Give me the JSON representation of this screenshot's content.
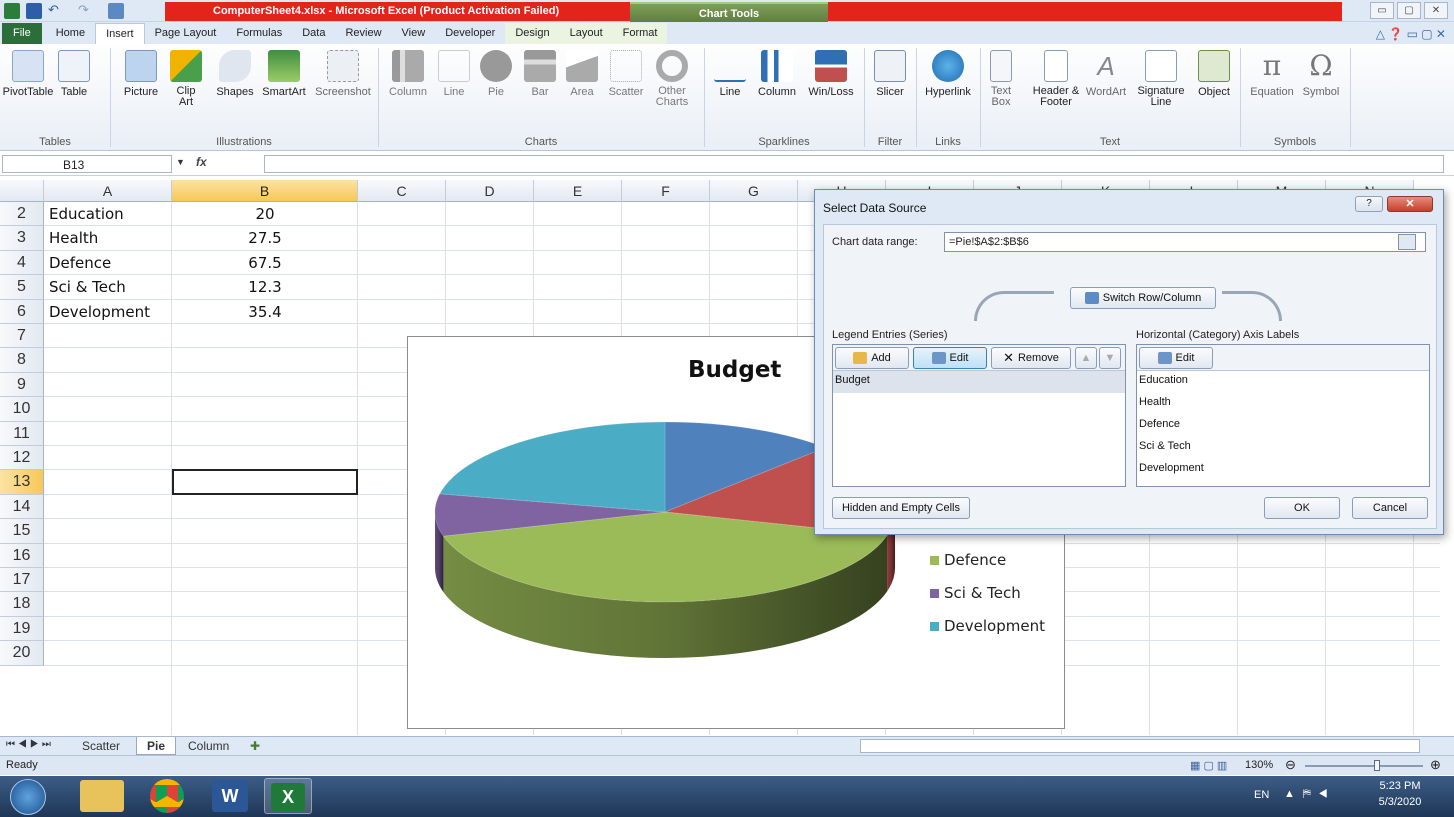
{
  "window": {
    "title": "ComputerSheet4.xlsx - Microsoft Excel (Product Activation Failed)",
    "contextual_tab_group": "Chart Tools",
    "controls": [
      "▭",
      "▢",
      "✕"
    ]
  },
  "tabs": [
    "File",
    "Home",
    "Insert",
    "Page Layout",
    "Formulas",
    "Data",
    "Review",
    "View",
    "Developer",
    "Design",
    "Layout",
    "Format"
  ],
  "active_tab": "Insert",
  "ribbon": {
    "groups": {
      "tables": "Tables",
      "illustrations": "Illustrations",
      "charts": "Charts",
      "sparklines": "Sparklines",
      "filter": "Filter",
      "links": "Links",
      "text": "Text",
      "symbols": "Symbols"
    },
    "buttons": {
      "pivottable": "PivotTable",
      "table": "Table",
      "picture": "Picture",
      "clipart": "Clip Art",
      "shapes": "Shapes",
      "smartart": "SmartArt",
      "screenshot": "Screenshot",
      "column": "Column",
      "line": "Line",
      "pie": "Pie",
      "bar": "Bar",
      "area": "Area",
      "scatter": "Scatter",
      "othercharts": "Other Charts",
      "spark_line": "Line",
      "spark_column": "Column",
      "spark_winloss": "Win/Loss",
      "slicer": "Slicer",
      "hyperlink": "Hyperlink",
      "textbox": "Text Box",
      "headerfooter": "Header & Footer",
      "wordart": "WordArt",
      "signature": "Signature Line",
      "object": "Object",
      "equation": "Equation",
      "symbol": "Symbol"
    }
  },
  "formula_bar": {
    "name_box": "B13",
    "fx": "fx",
    "value": ""
  },
  "columns": [
    "A",
    "B",
    "C",
    "D",
    "E",
    "F",
    "G",
    "H",
    "I",
    "J",
    "K",
    "L",
    "M",
    "N"
  ],
  "selected_column": "B",
  "rows": [
    "2",
    "3",
    "4",
    "5",
    "6",
    "7",
    "8",
    "9",
    "10",
    "11",
    "12",
    "13",
    "14",
    "15",
    "16",
    "17",
    "18",
    "19",
    "20"
  ],
  "selected_row": "13",
  "cells": [
    {
      "a": "Education",
      "b": "20"
    },
    {
      "a": "Health",
      "b": "27.5"
    },
    {
      "a": "Defence",
      "b": "67.5"
    },
    {
      "a": "Sci & Tech",
      "b": "12.3"
    },
    {
      "a": "Development",
      "b": "35.4"
    }
  ],
  "chart_data": {
    "type": "pie",
    "title": "Budget",
    "categories": [
      "Education",
      "Health",
      "Defence",
      "Sci & Tech",
      "Development"
    ],
    "values": [
      20,
      27.5,
      67.5,
      12.3,
      35.4
    ],
    "colors": [
      "#4f81bd",
      "#c0504d",
      "#9bbb59",
      "#8064a2",
      "#4bacc6"
    ],
    "legend_visible": [
      "Defence",
      "Sci & Tech",
      "Development"
    ],
    "legend_position": "right",
    "style": "3d"
  },
  "sheet_tabs": [
    "Scatter",
    "Pie",
    "Column"
  ],
  "active_sheet": "Pie",
  "status": {
    "ready": "Ready",
    "zoom": "130%"
  },
  "taskbar": {
    "lang": "EN",
    "time": "5:23 PM",
    "date": "5/3/2020"
  },
  "dialog": {
    "title": "Select Data Source",
    "help": "?",
    "close": "✕",
    "range_label": "Chart data range:",
    "range_value": "=Pie!$A$2:$B$6",
    "switch_label": "Switch Row/Column",
    "legend_label": "Legend Entries (Series)",
    "axis_label": "Horizontal (Category) Axis Labels",
    "add": "Add",
    "edit": "Edit",
    "remove": "Remove",
    "axis_edit": "Edit",
    "series": [
      "Budget"
    ],
    "axis_items": [
      "Education",
      "Health",
      "Defence",
      "Sci & Tech",
      "Development"
    ],
    "hidden_cells": "Hidden and Empty Cells",
    "ok": "OK",
    "cancel": "Cancel"
  }
}
